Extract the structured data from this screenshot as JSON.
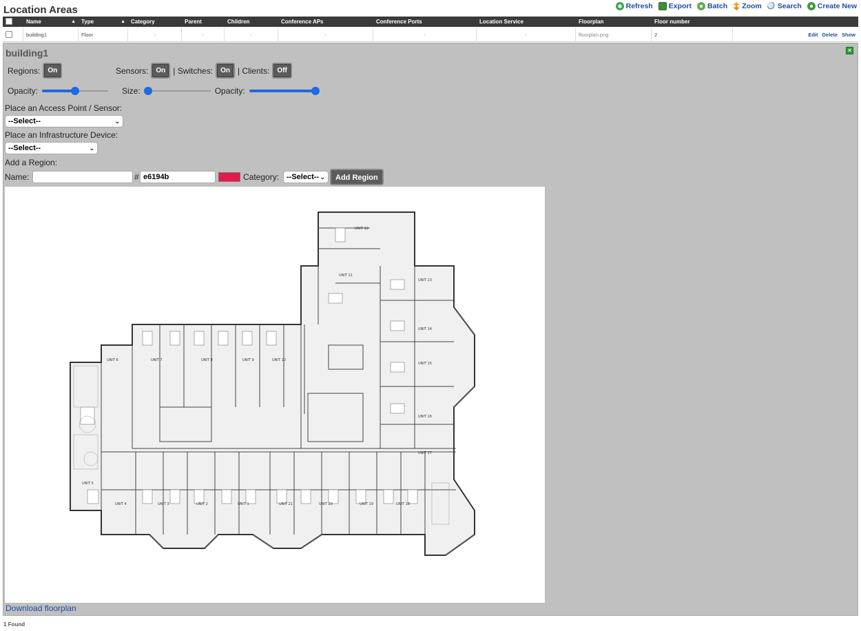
{
  "header": {
    "title": "Location Areas",
    "toolbar": [
      {
        "label": "Refresh",
        "icon": "refresh-icon"
      },
      {
        "label": "Export",
        "icon": "export-icon"
      },
      {
        "label": "Batch",
        "icon": "batch-icon"
      },
      {
        "label": "Zoom",
        "icon": "zoom-icon"
      },
      {
        "label": "Search",
        "icon": "search-icon"
      },
      {
        "label": "Create New",
        "icon": "create-icon"
      }
    ]
  },
  "table": {
    "columns": [
      "Name",
      "Type",
      "Category",
      "Parent",
      "Children",
      "Conference APs",
      "Conference Ports",
      "Location Service",
      "Floorplan",
      "Floor number"
    ],
    "row": {
      "name": "building1",
      "type": "Floor",
      "category": "-",
      "parent": "-",
      "children": "-",
      "conference_aps": "-",
      "conference_ports": "-",
      "location_service": "-",
      "floorplan": "floorplan.png",
      "floor_number": "2",
      "actions": [
        "Edit",
        "Delete",
        "Show"
      ]
    }
  },
  "detail": {
    "title": "building1",
    "regions_label": "Regions:",
    "regions_state": "On",
    "sensors_label": "Sensors:",
    "sensors_state": "On",
    "switches_label": "| Switches:",
    "switches_state": "On",
    "clients_label": "| Clients:",
    "clients_state": "Off",
    "opacity1_label": "Opacity:",
    "opacity1_value": 0.5,
    "size_label": "Size:",
    "size_value": 0.05,
    "opacity2_label": "Opacity:",
    "opacity2_value": 1.0,
    "place_ap_label": "Place an Access Point / Sensor:",
    "place_ap_value": "--Select--",
    "place_infra_label": "Place an Infrastructure Device:",
    "place_infra_value": "--Select--",
    "add_region_label": "Add a Region:",
    "name_label": "Name:",
    "name_value": "",
    "hash_label": "#",
    "color_value": "e6194b",
    "color_hex": "#e6194b",
    "category_label": "Category:",
    "category_value": "--Select--",
    "add_region_button": "Add Region",
    "download_link": "Download floorplan"
  },
  "footer": {
    "count": "1 Found"
  },
  "floorplan_units": [
    "UNIT 12",
    "UNIT 11",
    "UNIT 13",
    "UNIT 14",
    "UNIT 15",
    "UNIT 16",
    "UNIT 17",
    "UNIT 6",
    "UNIT 7",
    "UNIT 8",
    "UNIT 9",
    "UNIT 10",
    "UNIT 5",
    "UNIT 4",
    "UNIT 3",
    "UNIT 2",
    "UNIT 1",
    "UNIT 21",
    "UNIT 20",
    "UNIT 19",
    "UNIT 18"
  ]
}
